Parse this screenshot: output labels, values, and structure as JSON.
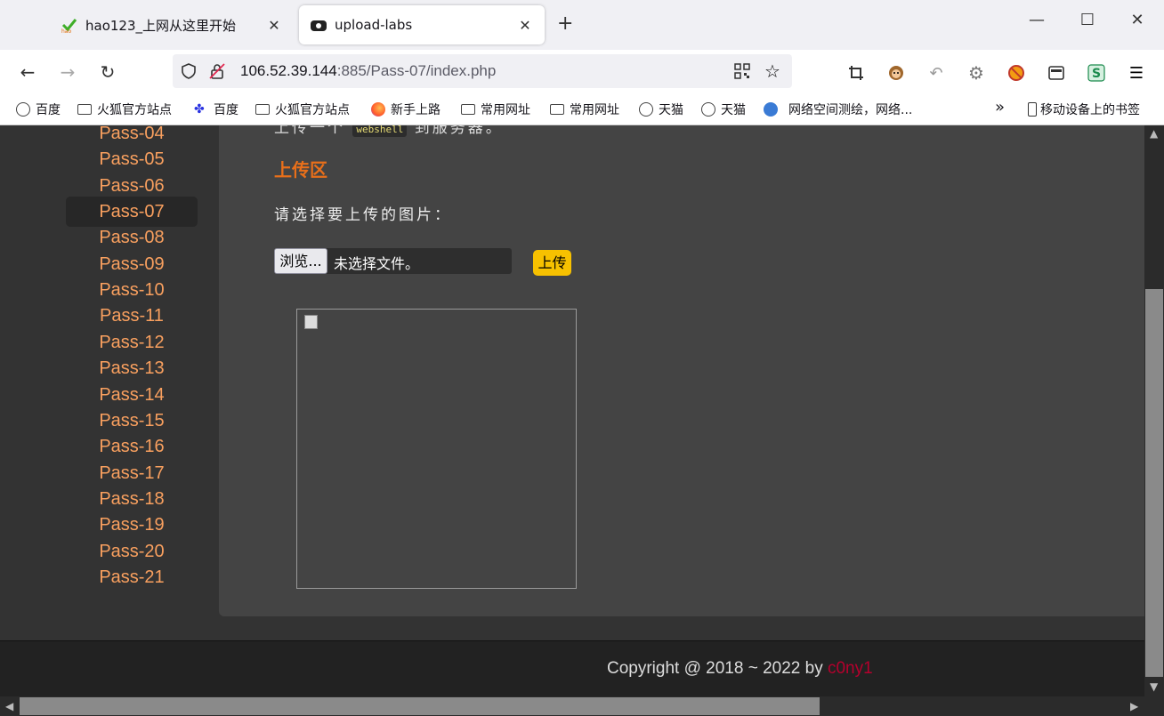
{
  "tabs": [
    {
      "title": "hao123_上网从这里开始",
      "active": false,
      "icon": "hao123-icon"
    },
    {
      "title": "upload-labs",
      "active": true,
      "icon": "upload-labs-icon"
    }
  ],
  "window": {
    "minimize": "—",
    "maximize": "☐",
    "close": "✕"
  },
  "address": {
    "host": "106.52.39.144",
    "rest": ":885/Pass-07/index.php"
  },
  "bookmarks": [
    {
      "label": "百度",
      "icon": "globe-icon"
    },
    {
      "label": "火狐官方站点",
      "icon": "folder-icon"
    },
    {
      "label": "百度",
      "icon": "baidu-paw-icon"
    },
    {
      "label": "火狐官方站点",
      "icon": "folder-icon"
    },
    {
      "label": "新手上路",
      "icon": "firefox-icon"
    },
    {
      "label": "常用网址",
      "icon": "folder-icon"
    },
    {
      "label": "常用网址",
      "icon": "folder-icon"
    },
    {
      "label": "天猫",
      "icon": "globe-icon"
    },
    {
      "label": "天猫",
      "icon": "globe-icon"
    },
    {
      "label": "网络空间测绘，网络...",
      "icon": "fofa-icon"
    }
  ],
  "bookmarks_overflow": "»",
  "mobile_bookmarks": "移动设备上的书签",
  "sidebar": {
    "items": [
      "Pass-04",
      "Pass-05",
      "Pass-06",
      "Pass-07",
      "Pass-08",
      "Pass-09",
      "Pass-10",
      "Pass-11",
      "Pass-12",
      "Pass-13",
      "Pass-14",
      "Pass-15",
      "Pass-16",
      "Pass-17",
      "Pass-18",
      "Pass-19",
      "Pass-20",
      "Pass-21"
    ],
    "active": "Pass-07"
  },
  "main": {
    "intro_before": "上传一个",
    "intro_code": "webshell",
    "intro_after": "到服务器。",
    "section_title": "上传区",
    "prompt": "请选择要上传的图片：",
    "browse_label": "浏览...",
    "no_file": "未选择文件。",
    "submit_label": "上传"
  },
  "footer": {
    "text": "Copyright @ 2018 ~ 2022 by ",
    "author": "c0ny1"
  },
  "colors": {
    "link": "#f9a05f",
    "section_title": "#e86f1a",
    "submit": "#f7c100",
    "author": "#b5002d"
  }
}
